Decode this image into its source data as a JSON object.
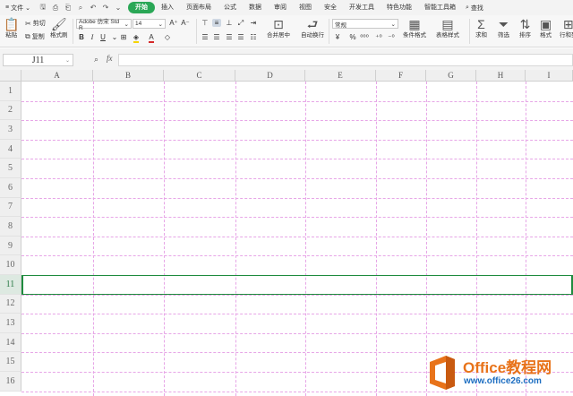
{
  "menubar": {
    "file_label": "文件",
    "tabs": [
      "开始",
      "插入",
      "页面布局",
      "公式",
      "数据",
      "审阅",
      "视图",
      "安全",
      "开发工具",
      "特色功能",
      "智能工具箱"
    ],
    "active_tab": "开始",
    "search_label": "查找"
  },
  "ribbon": {
    "paste": "粘贴",
    "cut": "剪切",
    "copy": "复制",
    "format_painter": "格式刷",
    "font_name": "Adobe 仿宋 Std R",
    "font_size": "14",
    "merge_center": "合并居中",
    "wrap_text": "自动换行",
    "number_format": "常规",
    "conditional_format": "条件格式",
    "table_style": "表格样式",
    "sum": "求和",
    "filter": "筛选",
    "sort": "排序",
    "format": "格式",
    "row_col": "行和列"
  },
  "formula_bar": {
    "name_box": "J11",
    "fx_label": "fx",
    "formula": ""
  },
  "sheet": {
    "columns": [
      "A",
      "B",
      "C",
      "D",
      "E",
      "F",
      "G",
      "H",
      "I"
    ],
    "rows": [
      "1",
      "2",
      "3",
      "4",
      "5",
      "6",
      "7",
      "8",
      "9",
      "10",
      "11",
      "12",
      "13",
      "14",
      "15",
      "16"
    ],
    "active_row": "11",
    "gridline_color": "#e7a6e7",
    "selection_color": "#1e8b3e"
  },
  "watermark": {
    "title": "Office教程网",
    "url": "www.office26.com"
  },
  "colors": {
    "active_tab": "#2aa756",
    "watermark_orange": "#e8731a",
    "watermark_blue": "#1d6ec1"
  }
}
